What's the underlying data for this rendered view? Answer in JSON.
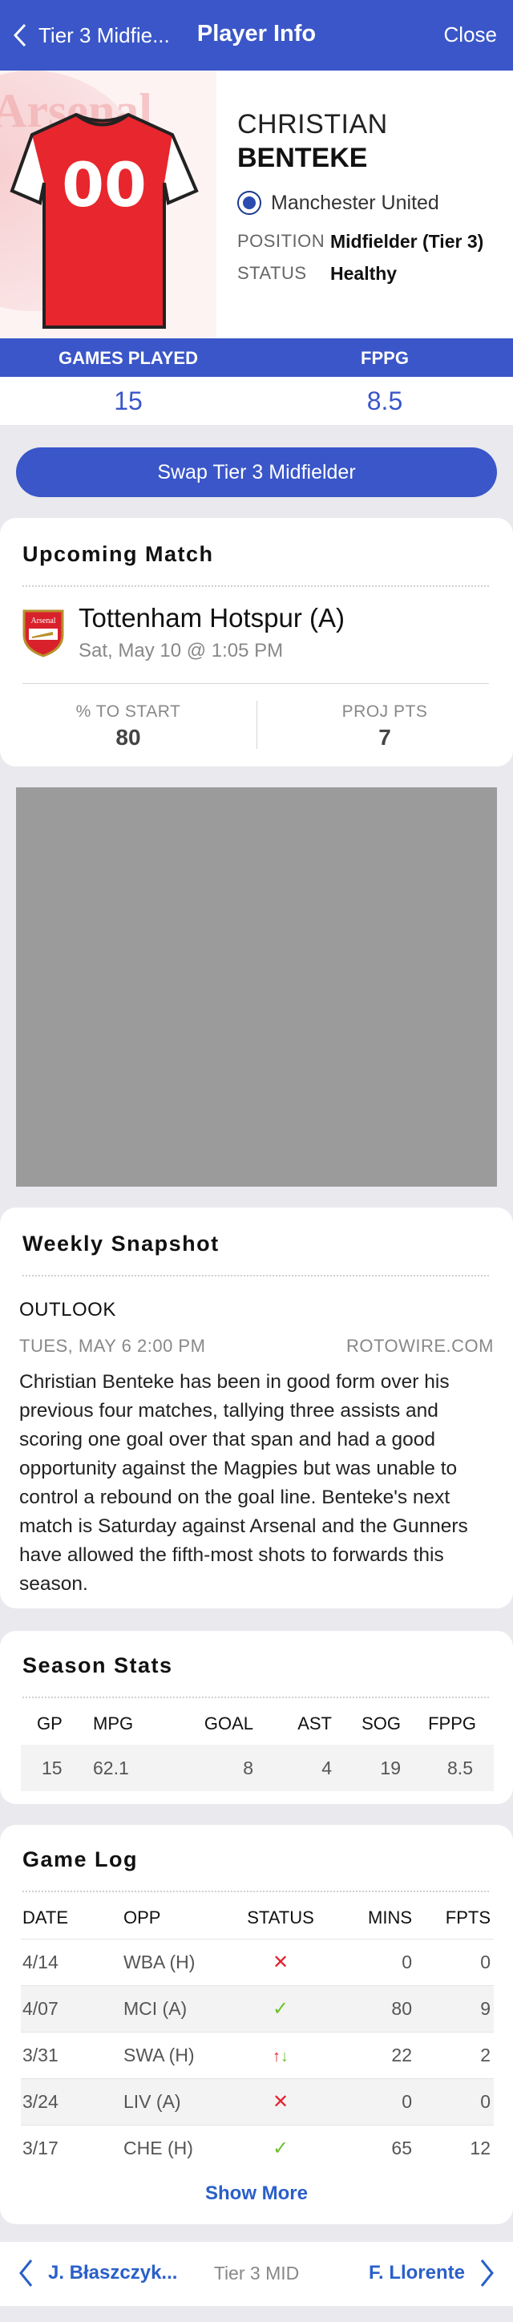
{
  "header": {
    "back_label": "Tier 3 Midfie...",
    "title": "Player Info",
    "close_label": "Close"
  },
  "player": {
    "first_name": "CHRISTIAN",
    "last_name": "BENTEKE",
    "team": "Manchester United",
    "jersey_number": "00",
    "position_label": "POSITION",
    "position": "Midfielder (Tier 3)",
    "status_label": "STATUS",
    "status": "Healthy",
    "jersey_color": "#e8262d",
    "crest_text": "Arsenal"
  },
  "summary": {
    "games_played_label": "GAMES PLAYED",
    "games_played": "15",
    "fppg_label": "FPPG",
    "fppg": "8.5"
  },
  "swap_button": "Swap Tier 3 Midfielder",
  "upcoming": {
    "title": "Upcoming Match",
    "opponent": "Tottenham Hotspur (A)",
    "datetime": "Sat, May 10 @ 1:05 PM",
    "start_label": "% TO START",
    "start_value": "80",
    "proj_label": "PROJ PTS",
    "proj_value": "7"
  },
  "snapshot": {
    "title": "Weekly Snapshot",
    "outlook_label": "OUTLOOK",
    "date": "TUES, MAY 6 2:00 PM",
    "source": "ROTOWIRE.COM",
    "body": "Christian Benteke has been in good form over his previous four matches, tallying three assists and scoring one goal over that span and had a good opportunity against the Magpies but was unable to control a rebound on the goal line. Benteke's next match is Saturday against Arsenal and the Gunners have allowed the fifth-most shots to forwards this season."
  },
  "season_stats": {
    "title": "Season Stats",
    "headers": [
      "GP",
      "MPG",
      "GOAL",
      "AST",
      "SOG",
      "FPPG"
    ],
    "values": [
      "15",
      "62.1",
      "8",
      "4",
      "19",
      "8.5"
    ]
  },
  "game_log": {
    "title": "Game Log",
    "headers": [
      "DATE",
      "OPP",
      "STATUS",
      "MINS",
      "FPTS"
    ],
    "rows": [
      {
        "date": "4/14",
        "opp": "WBA (H)",
        "status": "benched",
        "mins": "0",
        "fpts": "0"
      },
      {
        "date": "4/07",
        "opp": "MCI (A)",
        "status": "started",
        "mins": "80",
        "fpts": "9"
      },
      {
        "date": "3/31",
        "opp": "SWA (H)",
        "status": "subbed",
        "mins": "22",
        "fpts": "2"
      },
      {
        "date": "3/24",
        "opp": "LIV (A)",
        "status": "benched",
        "mins": "0",
        "fpts": "0"
      },
      {
        "date": "3/17",
        "opp": "CHE (H)",
        "status": "started",
        "mins": "65",
        "fpts": "12"
      }
    ],
    "show_more": "Show More"
  },
  "footer": {
    "prev": "J. Błaszczyk...",
    "middle": "Tier 3 MID",
    "next": "F. Llorente"
  },
  "colors": {
    "primary": "#3a56c8",
    "link": "#2a5fc9",
    "bad": "#e2242f",
    "good": "#6cc12b"
  }
}
